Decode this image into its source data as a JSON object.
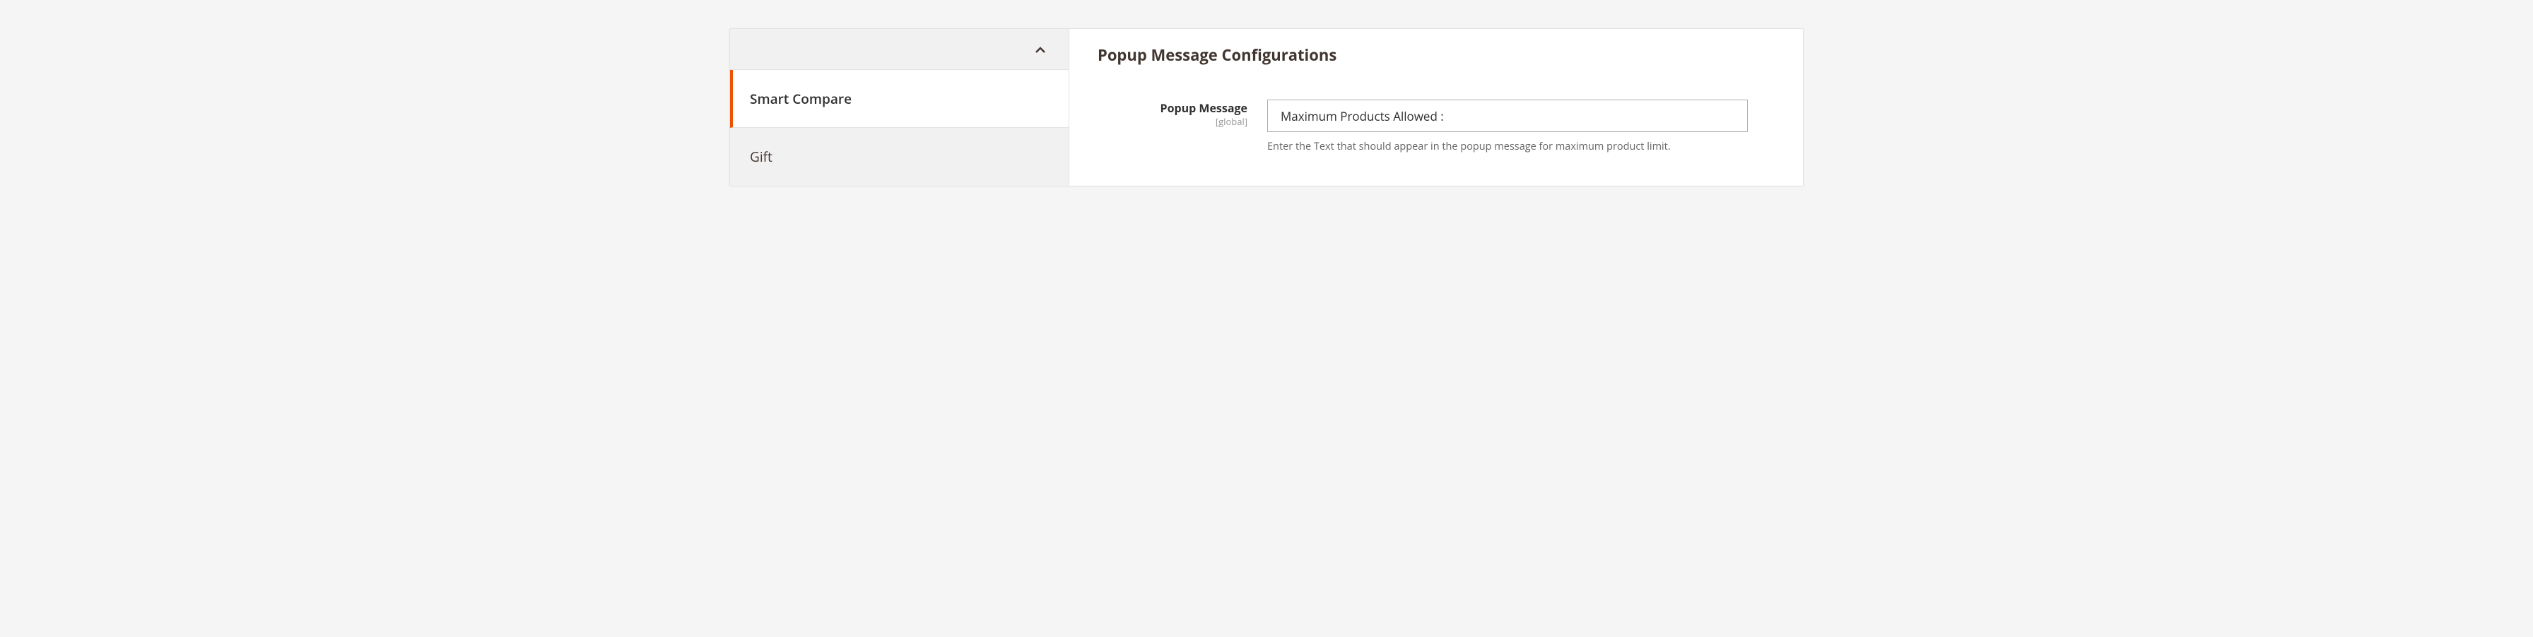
{
  "sidebar": {
    "items": [
      {
        "label": "Smart Compare",
        "active": true
      },
      {
        "label": "Gift",
        "active": false
      }
    ]
  },
  "content": {
    "title": "Popup Message Configurations",
    "field": {
      "label": "Popup Message",
      "scope": "[global]",
      "value": "Maximum Products Allowed :",
      "helper": "Enter the Text that should appear in the popup message for maximum product limit."
    }
  }
}
